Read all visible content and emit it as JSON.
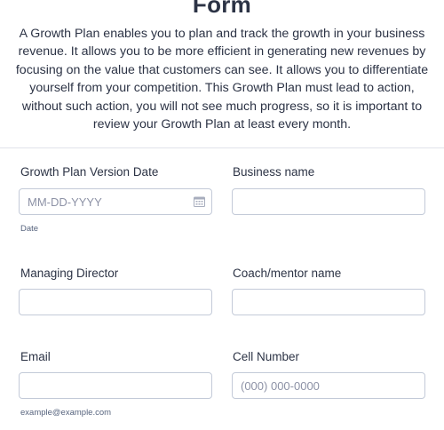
{
  "header": {
    "title": "Form",
    "description": "A Growth Plan enables you to plan and track the growth in your business revenue. It allows you to be more efficient in generating new revenues by focusing on the value that customers can see. It allows you to differentiate yourself from your competition. This Growth Plan must lead to action, without such action, you will not see much progress, so it is important to review your Growth Plan at least every month."
  },
  "fields": {
    "version_date": {
      "label": "Growth Plan Version Date",
      "placeholder": "MM-DD-YYYY",
      "sublabel": "Date",
      "icon": "calendar-icon"
    },
    "business_name": {
      "label": "Business name",
      "placeholder": ""
    },
    "managing_director": {
      "label": "Managing Director",
      "placeholder": ""
    },
    "coach_name": {
      "label": "Coach/mentor name",
      "placeholder": ""
    },
    "email": {
      "label": "Email",
      "placeholder": "",
      "sublabel": "example@example.com"
    },
    "cell_number": {
      "label": "Cell Number",
      "placeholder": "(000) 000-0000"
    }
  }
}
